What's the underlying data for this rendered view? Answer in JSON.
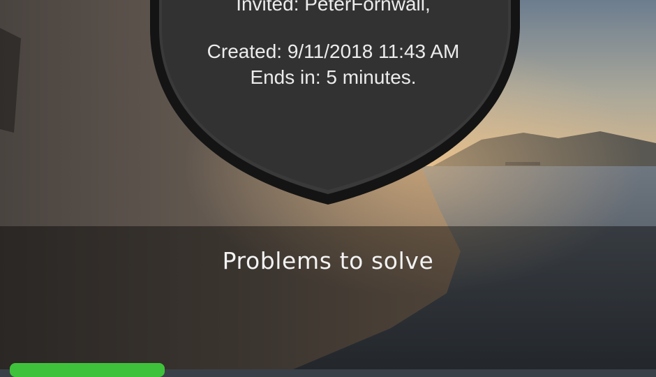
{
  "challenge": {
    "invited_line": "Invited: PeterFornwall,",
    "created_line": "Created:  9/11/2018 11:43 AM",
    "ends_line": "Ends in: 5 minutes."
  },
  "section": {
    "title": "Problems to solve"
  },
  "colors": {
    "accent_green": "#3fc23b",
    "shield_dark": "#2b2b2b",
    "overlay": "rgba(0,0,0,0.42)"
  },
  "icons": {
    "shield": "shield-badge"
  }
}
